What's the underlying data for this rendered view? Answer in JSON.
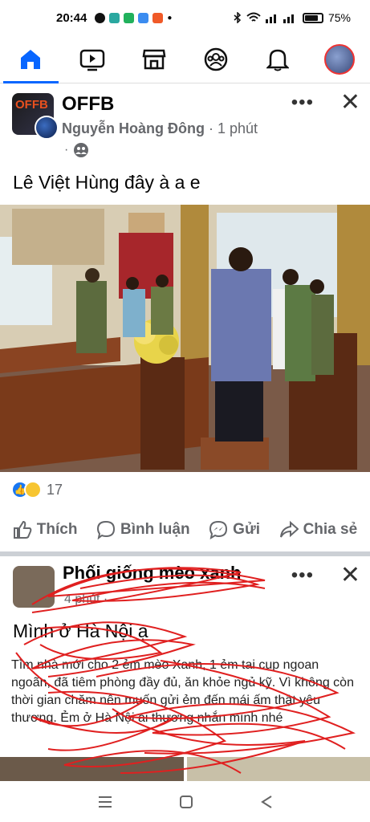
{
  "status_bar": {
    "time": "20:44",
    "battery": "75%",
    "battery_level": 0.75
  },
  "nav": {
    "tabs": [
      "home",
      "watch",
      "marketplace",
      "groups",
      "notifications",
      "profile"
    ],
    "active": "home"
  },
  "post1": {
    "page_name": "OFFB",
    "page_avatar_text": "OFFB",
    "author": "Nguyễn Hoàng Đông",
    "time": "· 1 phút",
    "audience_prefix": "·",
    "text": "Lê Việt Hùng đây à a e",
    "reaction_count": "17",
    "actions": {
      "like": "Thích",
      "comment": "Bình luận",
      "send": "Gửi",
      "share": "Chia sẻ"
    },
    "more": "•••"
  },
  "post2": {
    "name": "Phối giống mèo xanh",
    "meta": "4 phút ·",
    "title": "Mình ở Hà Nội ạ",
    "body": "Tìm nhà mới cho 2 ẻm mèo Xanh, 1 ẻm tai cụp ngoan ngoãn, đã tiêm phòng đầy đủ, ăn khỏe ngủ kỹ. Vì không còn thời gian chăm nên muốn gửi ẻm đến mái ấm thật yêu thương. Ẻm ở Hà Nội ai thương nhắn mình nhé",
    "more": "•••"
  },
  "colors": {
    "accent": "#0866ff",
    "secondary_text": "#65676b",
    "scribble": "#e02020"
  }
}
